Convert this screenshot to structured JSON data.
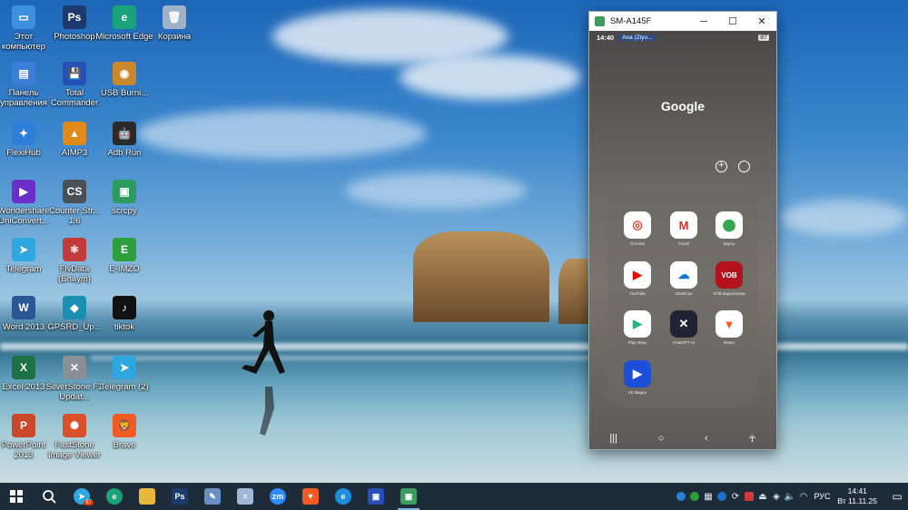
{
  "desktop": {
    "icons": [
      {
        "label": "Этот компьютер",
        "icon": "pc-icon",
        "color": "#3d8fe0",
        "glyph": "▭"
      },
      {
        "label": "Photoshop",
        "icon": "photoshop-icon",
        "color": "#1c3a6b",
        "glyph": "Ps"
      },
      {
        "label": "Microsoft Edge",
        "icon": "edge-icon",
        "color": "#1aa37a",
        "glyph": "e"
      },
      {
        "label": "Корзина",
        "icon": "recycle-bin-icon",
        "color": "#9fb3c8",
        "glyph": "🗑"
      },
      {
        "label": "Панель управления",
        "icon": "control-panel-icon",
        "color": "#3b7dd8",
        "glyph": "▤"
      },
      {
        "label": "Total Commander",
        "icon": "total-commander-icon",
        "color": "#2450b8",
        "glyph": "💾"
      },
      {
        "label": "USB Burni...",
        "icon": "usb-burning-icon",
        "color": "#c9882e",
        "glyph": "◉"
      },
      {
        "label": "FlexiHub",
        "icon": "flexihub-icon",
        "color": "#2d7fd8",
        "glyph": "✦"
      },
      {
        "label": "AIMP3",
        "icon": "aimp-icon",
        "color": "#e08a1a",
        "glyph": "▲"
      },
      {
        "label": "Adb Run",
        "icon": "adb-run-icon",
        "color": "#2a2a2a",
        "glyph": "🤖"
      },
      {
        "label": "Wondershare UniConvert...",
        "icon": "uniconverter-icon",
        "color": "#6a2fc8",
        "glyph": "▶"
      },
      {
        "label": "Counter Str... 1.6",
        "icon": "counter-strike-icon",
        "color": "#4b4f58",
        "glyph": "CS"
      },
      {
        "label": "scrcpy",
        "icon": "scrcpy-icon",
        "color": "#2f9a5e",
        "glyph": "▣"
      },
      {
        "label": "Telegram",
        "icon": "telegram-icon",
        "color": "#2ea6e0",
        "glyph": "➤"
      },
      {
        "label": "FlvData (Блaym)",
        "icon": "atom-icon",
        "color": "#c23a3a",
        "glyph": "⚛"
      },
      {
        "label": "E-IMZO",
        "icon": "eimzo-icon",
        "color": "#2c9e3c",
        "glyph": "E"
      },
      {
        "label": "Word 2013",
        "icon": "word-icon",
        "color": "#2b5797",
        "glyph": "W"
      },
      {
        "label": "GPSRD_Up...",
        "icon": "gpsrd-icon",
        "color": "#1a8fb0",
        "glyph": "◆"
      },
      {
        "label": "tiktok",
        "icon": "tiktok-icon",
        "color": "#111111",
        "glyph": "♪"
      },
      {
        "label": "Excel 2013",
        "icon": "excel-icon",
        "color": "#1e7145",
        "glyph": "X"
      },
      {
        "label": "SilverStone F1 Updat...",
        "icon": "silverstone-icon",
        "color": "#8a8f96",
        "glyph": "✕"
      },
      {
        "label": "Telegram (2)",
        "icon": "telegram-2-icon",
        "color": "#2ea6e0",
        "glyph": "➤"
      },
      {
        "label": "PowerPoint 2013",
        "icon": "powerpoint-icon",
        "color": "#c9472a",
        "glyph": "P"
      },
      {
        "label": "FastStone Image Viewer",
        "icon": "faststone-icon",
        "color": "#d94f2a",
        "glyph": "✺"
      },
      {
        "label": "Brave",
        "icon": "brave-icon",
        "color": "#f25a24",
        "glyph": "🦁"
      }
    ]
  },
  "phone": {
    "window_title": "SM-A145F",
    "status_time": "14:40",
    "status_notification": "Ana (Ziyo...",
    "battery": "87",
    "home_label": "Google",
    "apps": [
      {
        "label": "Chrome",
        "icon": "chrome-icon",
        "color": "#ffffff",
        "glyph": "◎",
        "glyph_color": "#db4437"
      },
      {
        "label": "Gmail",
        "icon": "gmail-icon",
        "color": "#ffffff",
        "glyph": "M",
        "glyph_color": "#d93025"
      },
      {
        "label": "Карты",
        "icon": "maps-icon",
        "color": "#ffffff",
        "glyph": "⬤",
        "glyph_color": "#34a853"
      },
      {
        "label": "YouTube",
        "icon": "youtube-icon",
        "color": "#ffffff",
        "glyph": "▶",
        "glyph_color": "#ff0000"
      },
      {
        "label": "OneDrive",
        "icon": "onedrive-icon",
        "color": "#ffffff",
        "glyph": "☁",
        "glyph_color": "#0f78d4"
      },
      {
        "label": "VOB видеоплеер",
        "icon": "vob-icon",
        "color": "#b3141b",
        "glyph": "VOB",
        "glyph_color": "#ffffff"
      },
      {
        "label": "Play Игры",
        "icon": "play-games-icon",
        "color": "#ffffff",
        "glyph": "▶",
        "glyph_color": "#1eb980"
      },
      {
        "label": "ChatGPT AI",
        "icon": "chatgpt-icon",
        "color": "#1f2333",
        "glyph": "✕",
        "glyph_color": "#ffffff"
      },
      {
        "label": "Brave",
        "icon": "brave-app-icon",
        "color": "#ffffff",
        "glyph": "▼",
        "glyph_color": "#f25a24"
      },
      {
        "label": "VK Видео",
        "icon": "vk-video-icon",
        "color": "#1d4fd8",
        "glyph": "▶",
        "glyph_color": "#ffffff"
      }
    ]
  },
  "taskbar": {
    "telegram_badge": "67",
    "language": "РУС",
    "time": "14:41",
    "date": "Вт 11.11.25"
  }
}
